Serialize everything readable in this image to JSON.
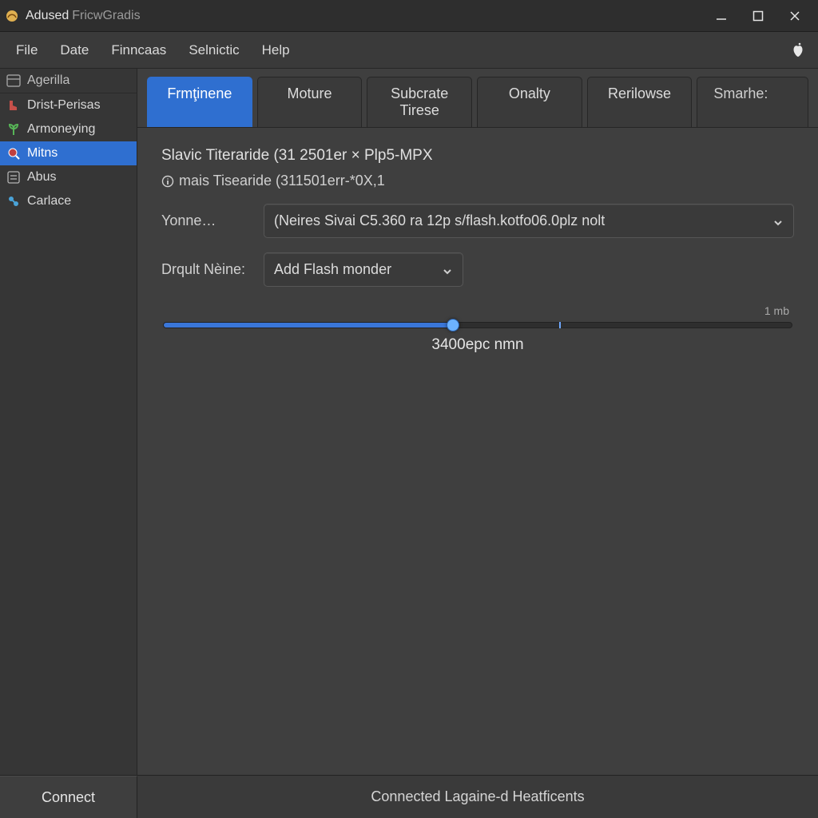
{
  "window": {
    "title_strong": "Adused",
    "title_rest": "FricwGradis"
  },
  "menubar": {
    "items": [
      "File",
      "Date",
      "Finncaas",
      "Selnictic",
      "Help"
    ]
  },
  "sidebar": {
    "heading": "Agerilla",
    "items": [
      {
        "label": "Drist-Perisas",
        "icon": "boot-icon"
      },
      {
        "label": "Armoneying",
        "icon": "plant-icon"
      },
      {
        "label": "Mitns",
        "icon": "search-globe-icon",
        "selected": true
      },
      {
        "label": "Abus",
        "icon": "slider-icon"
      },
      {
        "label": "Carlace",
        "icon": "config-icon"
      }
    ]
  },
  "tabs": [
    {
      "label": "Frmţinene",
      "active": true
    },
    {
      "label": "Moture"
    },
    {
      "label": "Subcrate Tirese"
    },
    {
      "label": "Onalty"
    },
    {
      "label": "Rerilowse"
    },
    {
      "label": "Smarhe:"
    }
  ],
  "content": {
    "heading": "Slavic Titeraride (31 2501er × Plp5-MPX",
    "subheading": "mais Tisearide (311501err-*0X,1",
    "yonne_label": "Yonne…",
    "yonne_value": "(Neires Sivai C5.360 ra 12p s/flash.kotfo06.0plz nolt",
    "drqult_label": "Drqult Nèine:",
    "drqult_value": "Add Flash monder",
    "slider": {
      "max_label": "1 mb",
      "value_label": "3400epc nmn",
      "percent": 46
    }
  },
  "bottom": {
    "connect": "Connect",
    "status": "Connected Lagaine-d Heatficents"
  }
}
